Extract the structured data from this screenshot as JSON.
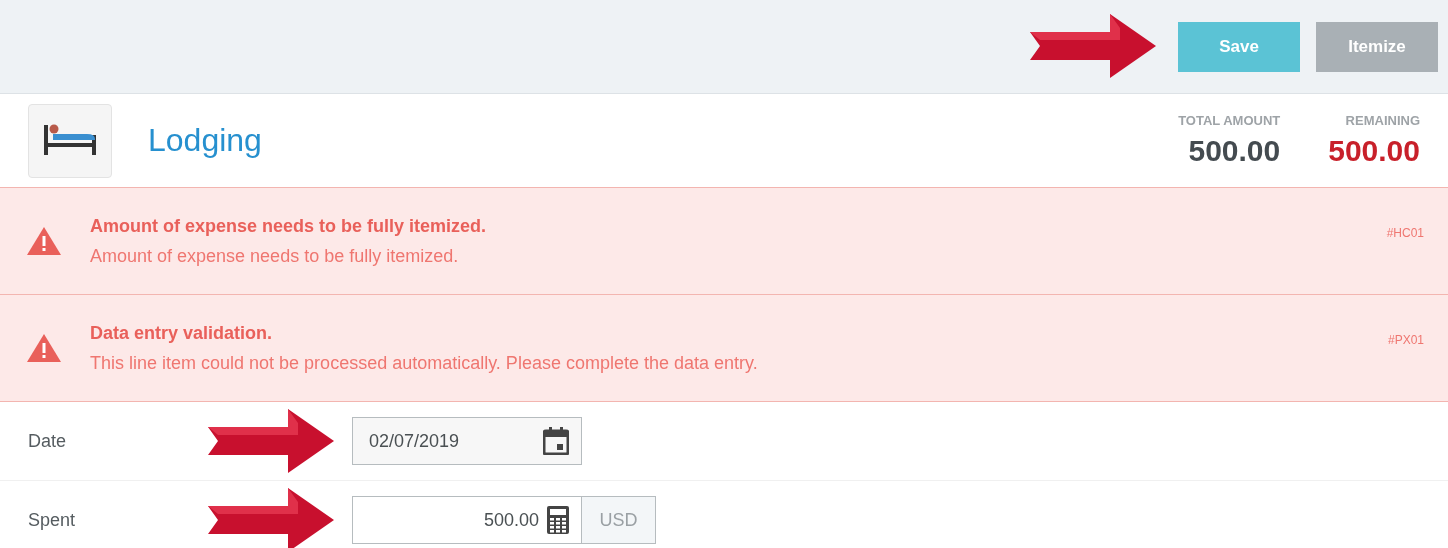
{
  "toolbar": {
    "buttons": [
      {
        "label": "Save",
        "disabled": false
      },
      {
        "label": "Itemize",
        "disabled": true
      }
    ]
  },
  "header": {
    "title": "Lodging",
    "totals": [
      {
        "label": "TOTAL AMOUNT",
        "value": "500.00",
        "kind": "normal"
      },
      {
        "label": "REMAINING",
        "value": "500.00",
        "kind": "alert"
      }
    ]
  },
  "alerts": [
    {
      "title": "Amount of expense needs to be fully itemized.",
      "message": "Amount of expense needs to be fully itemized.",
      "code": "#HC01"
    },
    {
      "title": "Data entry validation.",
      "message": "This line item could not be processed automatically. Please complete the data entry.",
      "code": "#PX01"
    }
  ],
  "fields": [
    {
      "label": "Date",
      "kind": "date",
      "value": "02/07/2019"
    },
    {
      "label": "Spent",
      "kind": "amount",
      "value": "500.00",
      "currency": "USD"
    }
  ]
}
